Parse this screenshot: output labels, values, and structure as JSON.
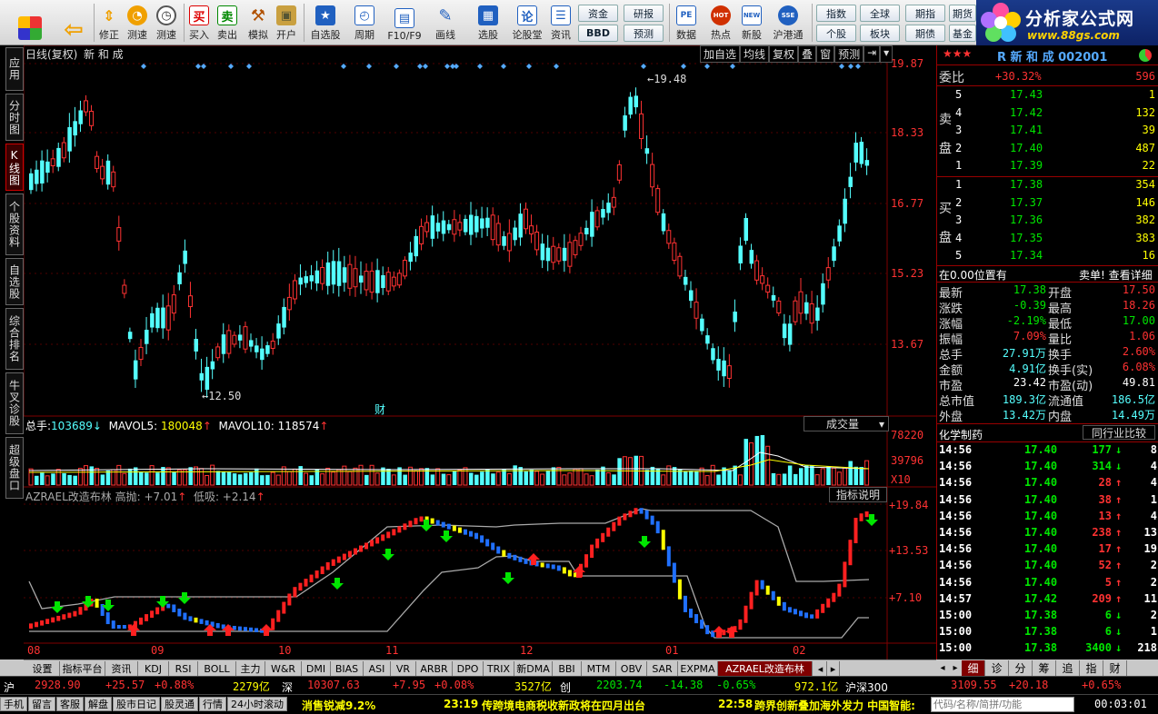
{
  "toolbar": {
    "buttons": [
      {
        "label": "",
        "icon": "menu-grid-icon",
        "color": "#2060c0"
      },
      {
        "label": "",
        "icon": "back-arrow-icon",
        "color": "#f0a000"
      },
      {
        "label": "修正",
        "icon": "up-down-icon",
        "color": "#f0a000"
      },
      {
        "label": "测速",
        "icon": "speed-icon",
        "color": "#f0a000"
      },
      {
        "label": "",
        "icon": "clock-icon",
        "color": "#888"
      },
      {
        "label": "买入",
        "icon": "buy-icon",
        "glyph": "买",
        "color": "#d00000"
      },
      {
        "label": "卖出",
        "icon": "sell-icon",
        "glyph": "卖",
        "color": "#008000"
      },
      {
        "label": "模拟",
        "icon": "hammer-icon",
        "color": "#b05000"
      },
      {
        "label": "开户",
        "icon": "lock-icon",
        "color": "#a07000"
      },
      {
        "label": "自选股",
        "icon": "star-folder-icon",
        "color": "#2060c0"
      },
      {
        "label": "周期",
        "icon": "period-icon",
        "color": "#2060c0"
      },
      {
        "label": "F10/F9",
        "icon": "f10-icon",
        "color": "#2060c0"
      },
      {
        "label": "画线",
        "icon": "pen-icon",
        "color": "#2060c0"
      },
      {
        "label": "选股",
        "icon": "select-stock-icon",
        "color": "#2060c0"
      },
      {
        "label": "论股堂",
        "icon": "forum-icon",
        "glyph": "论",
        "color": "#2060c0"
      },
      {
        "label": "资讯",
        "icon": "news-icon",
        "color": "#2060c0"
      },
      {
        "label": "数据",
        "icon": "data-icon",
        "glyph": "PE",
        "color": "#2060c0"
      },
      {
        "label": "热点",
        "icon": "hot-icon",
        "glyph": "HOT",
        "color": "#d03000"
      },
      {
        "label": "新股",
        "icon": "newstock-icon",
        "glyph": "NEW",
        "color": "#2060c0"
      },
      {
        "label": "沪港通",
        "icon": "sse-hk-icon",
        "glyph": "SSE",
        "color": "#2060c0"
      }
    ],
    "small_buttons": [
      "资金",
      "研报",
      "BBD",
      "预测",
      "指数",
      "全球",
      "个股",
      "板块",
      "期指",
      "期债",
      "期货",
      "基金"
    ]
  },
  "logo": {
    "title": "分析家公式网",
    "url": "www.88gs.com"
  },
  "sidetabs": [
    "应用",
    "分时图",
    "K线图",
    "个股资料",
    "自选股",
    "综合排名",
    "牛叉诊股",
    "超级盘口"
  ],
  "chart": {
    "header": {
      "period": "日线(复权)",
      "name": "新 和 成"
    },
    "header_buttons": [
      "加自选",
      "均线",
      "复权",
      "叠",
      "窗",
      "预测"
    ],
    "price_axis": [
      "19.87",
      "18.33",
      "16.77",
      "15.23",
      "13.67"
    ],
    "high_label": "19.48",
    "low_label": "12.50",
    "cai": "财",
    "vol_header": {
      "label1": "总手:",
      "v1": "103689",
      "label2": "MAVOL5:",
      "v2": "180048",
      "label3": "MAVOL10:",
      "v3": "118574"
    },
    "vol_button": "成交量",
    "vol_axis": [
      "78220",
      "39796",
      "X10"
    ],
    "ind_header": {
      "name": "AZRAEL改造布林",
      "h": "高抛: +7.01",
      "l": "低吸: +2.14"
    },
    "ind_button": "指标说明",
    "ind_axis": [
      "+19.84",
      "+13.53",
      "+7.10"
    ],
    "xlabels": [
      "08",
      "09",
      "10",
      "11",
      "12",
      "01",
      "02"
    ]
  },
  "quote": {
    "stars": "★★★",
    "code_label": "R 新 和 成 002001",
    "weibi": {
      "label": "委比",
      "pct": "+30.32%",
      "diff": "596"
    },
    "sell_label": "卖盘",
    "buy_label": "买盘",
    "asks": [
      [
        "5",
        "17.43",
        "1"
      ],
      [
        "4",
        "17.42",
        "132"
      ],
      [
        "3",
        "17.41",
        "39"
      ],
      [
        "2",
        "17.40",
        "487"
      ],
      [
        "1",
        "17.39",
        "22"
      ]
    ],
    "bids": [
      [
        "1",
        "17.38",
        "354"
      ],
      [
        "2",
        "17.37",
        "146"
      ],
      [
        "3",
        "17.36",
        "382"
      ],
      [
        "4",
        "17.35",
        "383"
      ],
      [
        "5",
        "17.34",
        "16"
      ]
    ],
    "pos_left": "在0.00位置有",
    "pos_right": "卖单! 查看详细",
    "stats": [
      [
        "最新",
        "17.38",
        "开盘",
        "17.50"
      ],
      [
        "涨跌",
        "-0.39",
        "最高",
        "18.26"
      ],
      [
        "涨幅",
        "-2.19%",
        "最低",
        "17.00"
      ],
      [
        "振幅",
        "7.09%",
        "量比",
        "1.06"
      ],
      [
        "总手",
        "27.91万",
        "换手",
        "2.60%"
      ],
      [
        "金额",
        "4.91亿",
        "换手(实)",
        "6.08%"
      ],
      [
        "市盈",
        "23.42",
        "市盈(动)",
        "49.81"
      ],
      [
        "总市值",
        "189.3亿",
        "流通值",
        "186.5亿"
      ],
      [
        "外盘",
        "13.42万",
        "内盘",
        "14.49万"
      ]
    ],
    "industry": "化学制药",
    "industry_btn": "同行业比较",
    "ticks": [
      [
        "14:56",
        "17.40",
        "177",
        "↓",
        "8"
      ],
      [
        "14:56",
        "17.40",
        "314",
        "↓",
        "4"
      ],
      [
        "14:56",
        "17.40",
        "28",
        "↑",
        "4"
      ],
      [
        "14:56",
        "17.40",
        "38",
        "↑",
        "1"
      ],
      [
        "14:56",
        "17.40",
        "13",
        "↑",
        "4"
      ],
      [
        "14:56",
        "17.40",
        "238",
        "↑",
        "13"
      ],
      [
        "14:56",
        "17.40",
        "17",
        "↑",
        "19"
      ],
      [
        "14:56",
        "17.40",
        "52",
        "↑",
        "2"
      ],
      [
        "14:56",
        "17.40",
        "5",
        "↑",
        "2"
      ],
      [
        "14:57",
        "17.42",
        "209",
        "↑",
        "11"
      ],
      [
        "15:00",
        "17.38",
        "6",
        "↓",
        "2"
      ],
      [
        "15:00",
        "17.38",
        "6",
        "↓",
        "1"
      ],
      [
        "15:00",
        "17.38",
        "3400",
        "↓",
        "218"
      ]
    ],
    "small_tabs": [
      "细",
      "诊",
      "分",
      "筹",
      "追",
      "指",
      "财"
    ]
  },
  "bottom_tabs": [
    "设置",
    "指标平台",
    "资讯",
    "KDJ",
    "RSI",
    "BOLL",
    "主力",
    "W&R",
    "DMI",
    "BIAS",
    "ASI",
    "VR",
    "ARBR",
    "DPO",
    "TRIX",
    "新DMA",
    "BBI",
    "MTM",
    "OBV",
    "SAR",
    "EXPMA",
    "AZRAEL改造布林"
  ],
  "status1": {
    "sh_label": "沪",
    "sh": "2928.90",
    "sh_chg": "+25.57",
    "sh_pct": "+0.88%",
    "sh_amt": "2279亿",
    "sz_label": "深",
    "sz": "10307.63",
    "sz_chg": "+7.95",
    "sz_pct": "+0.08%",
    "sz_amt": "3527亿",
    "cy_label": "创",
    "cy": "2203.74",
    "cy_chg": "-14.38",
    "cy_pct": "-0.65%",
    "cy_amt": "972.1亿",
    "hs_label": "沪深300",
    "hs": "3109.55",
    "hs_chg": "+20.18",
    "hs_pct": "+0.65%"
  },
  "status2": {
    "buttons": [
      "手机",
      "留言",
      "客服",
      "解盘",
      "股市日记",
      "股灵通",
      "行情",
      "24小时滚动"
    ],
    "news1": "消售锐减9.2%",
    "t1": "23:19",
    "news2": "传跨境电商税收新政将在四月出台",
    "t2": "22:58",
    "news3": "跨界创新叠加海外发力 中国智能:",
    "search_placeholder": "代码/名称/简拼/功能",
    "clock": "00:03:01"
  }
}
